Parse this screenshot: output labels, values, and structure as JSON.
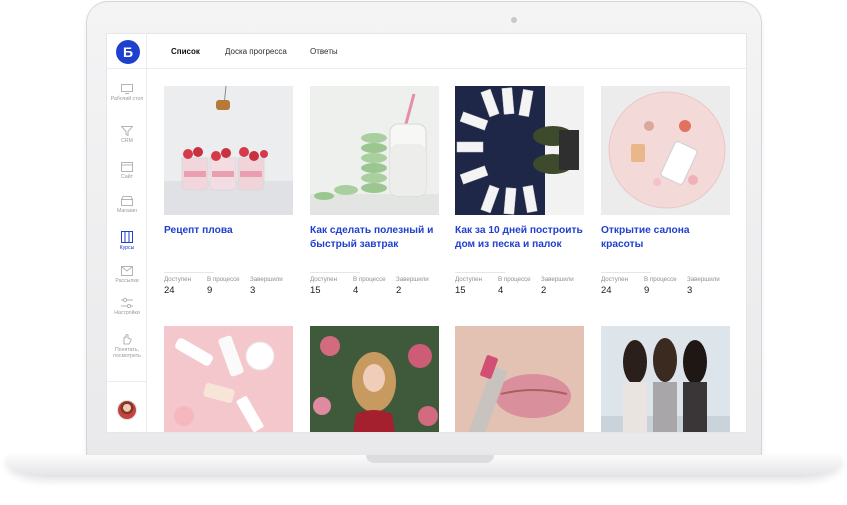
{
  "app": {
    "logo_letter": "Б"
  },
  "tabs": [
    {
      "label": "Список",
      "active": true
    },
    {
      "label": "Доска прогресса",
      "active": false
    },
    {
      "label": "Ответы",
      "active": false
    }
  ],
  "sidebar": {
    "items": [
      {
        "label": "Рабочий стол",
        "icon": "desktop-icon",
        "active": false
      },
      {
        "label": "CRM",
        "icon": "funnel-icon",
        "active": false
      },
      {
        "label": "Сайт",
        "icon": "site-icon",
        "active": false
      },
      {
        "label": "Магазин",
        "icon": "shop-icon",
        "active": false
      },
      {
        "label": "Курсы",
        "icon": "courses-icon",
        "active": true
      },
      {
        "label": "Рассылки",
        "icon": "mail-icon",
        "active": false
      },
      {
        "label": "Настройки",
        "icon": "sliders-icon",
        "active": false
      },
      {
        "label": "Понятать, посмотреть",
        "icon": "hand-icon",
        "active": false
      }
    ]
  },
  "stats_labels": {
    "available": "Доступен",
    "in_progress": "В процессе",
    "finished": "Завершили"
  },
  "courses": [
    {
      "title": "Рецепт плова",
      "available": "24",
      "in_progress": "9",
      "finished": "3"
    },
    {
      "title": "Как сделать полезный и быстрый завтрак",
      "available": "15",
      "in_progress": "4",
      "finished": "2"
    },
    {
      "title": "Как за 10 дней построить дом из песка и палок",
      "available": "15",
      "in_progress": "4",
      "finished": "2"
    },
    {
      "title": "Открытие салона красоты",
      "available": "24",
      "in_progress": "9",
      "finished": "3"
    }
  ],
  "colors": {
    "accent": "#1f3fcf",
    "muted": "#8f8f96"
  }
}
